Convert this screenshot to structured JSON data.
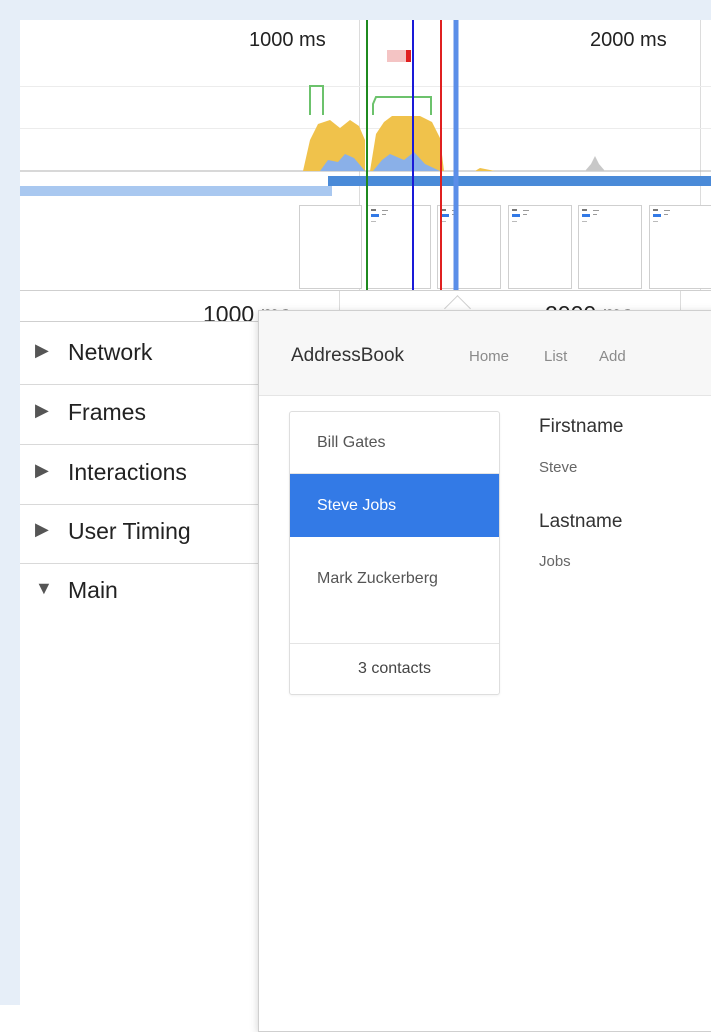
{
  "timeline": {
    "top_ruler": {
      "label_1000": "1000 ms",
      "label_2000": "2000 ms"
    },
    "lower_ruler": {
      "label_1000": "1000 ms",
      "label_2000": "2000 ms"
    },
    "colors": {
      "scripting": "#f0c24b",
      "rendering": "#8ab0e8",
      "idle_gray": "#c8c8c8",
      "frames_green": "#6cc26c",
      "network_blue": "#4a8ad8",
      "network_light": "#a9c8f0",
      "marker_green": "#1f8a1f",
      "marker_blue": "#1a1ad8",
      "marker_red": "#e02020",
      "cursor_blue": "#5b8ee8"
    }
  },
  "tracks": [
    {
      "label": "Network",
      "expanded": false,
      "icon": "triangle-right"
    },
    {
      "label": "Frames",
      "expanded": false,
      "icon": "triangle-right"
    },
    {
      "label": "Interactions",
      "expanded": false,
      "icon": "triangle-right"
    },
    {
      "label": "User Timing",
      "expanded": false,
      "icon": "triangle-right"
    },
    {
      "label": "Main",
      "expanded": true,
      "icon": "triangle-down"
    }
  ],
  "app": {
    "brand": "AddressBook",
    "nav": [
      "Home",
      "List",
      "Add"
    ],
    "contacts": [
      "Bill Gates",
      "Steve Jobs",
      "Mark Zuckerberg"
    ],
    "selected_contact": "Steve Jobs",
    "count_text": "3 contacts",
    "details": [
      {
        "label": "Firstname",
        "value": "Steve"
      },
      {
        "label": "Lastname",
        "value": "Jobs"
      }
    ]
  }
}
